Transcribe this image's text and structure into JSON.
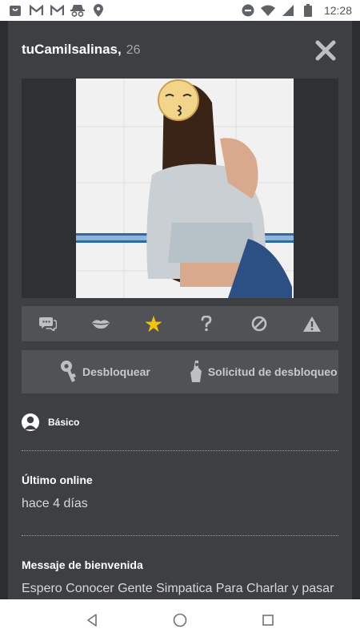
{
  "status_bar": {
    "time": "12:28",
    "left_icons": [
      "shopping-bag-icon",
      "gmail-icon",
      "gmail-icon",
      "incognito-icon",
      "location-pin-icon"
    ],
    "right_icons": [
      "do-not-disturb-icon",
      "wifi-icon",
      "signal-icon",
      "battery-icon"
    ]
  },
  "profile": {
    "username": "tuCamilsalinas,",
    "age": "26"
  },
  "actions": [
    "chat-icon",
    "kiss-icon",
    "star-icon",
    "question-icon",
    "block-icon",
    "warning-icon"
  ],
  "unlock": {
    "unlock_label": "Desbloquear",
    "request_label": "Solicitud de desbloqueo"
  },
  "membership": {
    "label": "Básico"
  },
  "last_online": {
    "title": "Último online",
    "value": "hace 4 días"
  },
  "welcome": {
    "title": "Messaje de bienvenida",
    "value": "Espero Conocer Gente Simpatica Para Charlar y pasar"
  },
  "colors": {
    "panel": "#3d3f42",
    "backdrop": "#2b2d30",
    "bar": "#505256",
    "star": "#f4c20d"
  }
}
